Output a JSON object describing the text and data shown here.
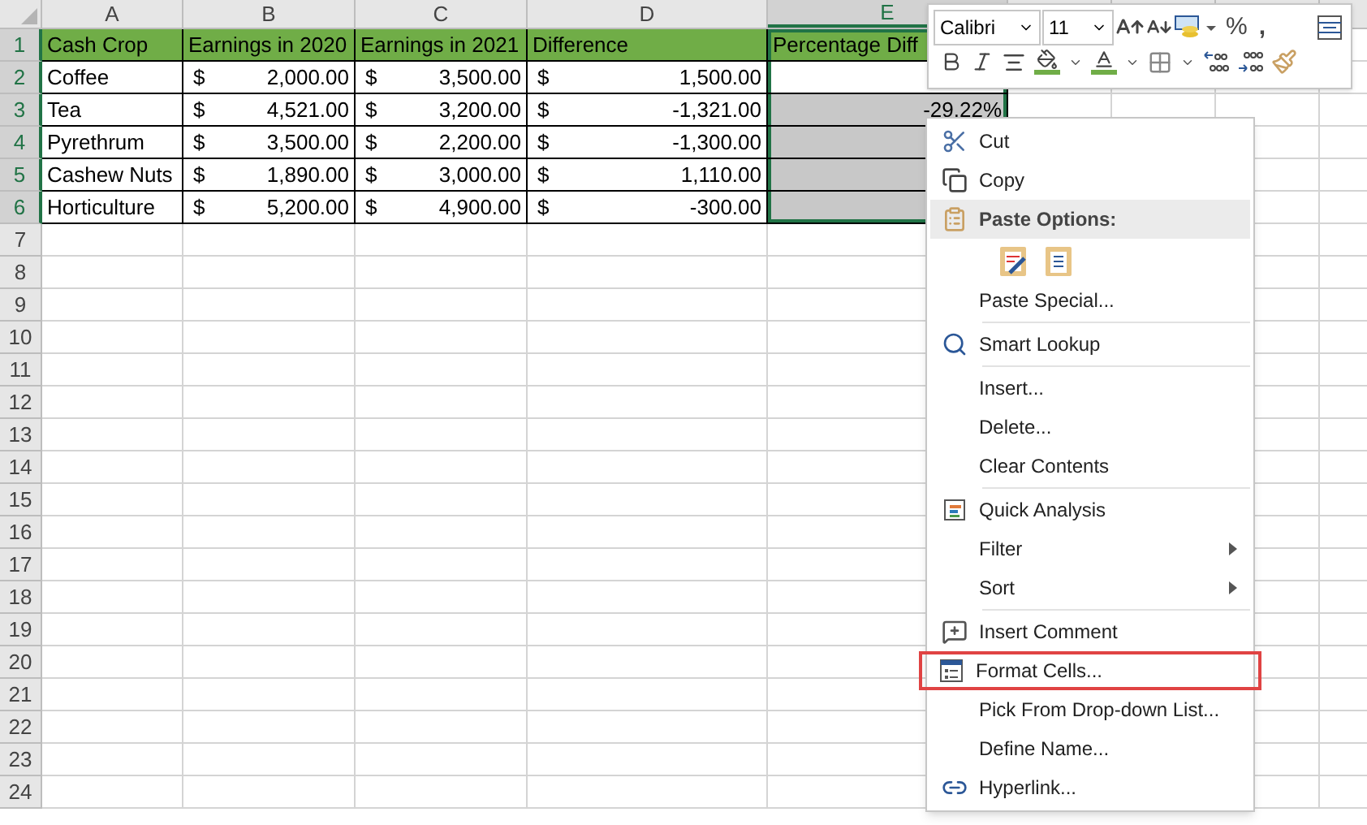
{
  "columns": [
    {
      "label": "A",
      "selected": false
    },
    {
      "label": "B",
      "selected": false
    },
    {
      "label": "C",
      "selected": false
    },
    {
      "label": "D",
      "selected": false
    },
    {
      "label": "E",
      "selected": true
    }
  ],
  "rows": [
    {
      "label": "1",
      "selected": true,
      "cells": [
        {
          "kind": "header",
          "text": "Cash Crop"
        },
        {
          "kind": "header",
          "text": "Earnings in 2020"
        },
        {
          "kind": "header",
          "text": "Earnings in 2021"
        },
        {
          "kind": "header",
          "text": "Difference"
        },
        {
          "kind": "header",
          "text": "Percentage Diff"
        }
      ]
    },
    {
      "label": "2",
      "selected": true,
      "cells": [
        {
          "kind": "text",
          "text": "Coffee"
        },
        {
          "kind": "currency",
          "symbol": "$",
          "amount": "2,000.00"
        },
        {
          "kind": "currency",
          "symbol": "$",
          "amount": "3,500.00"
        },
        {
          "kind": "currency",
          "symbol": "$",
          "amount": "1,500.00"
        },
        {
          "kind": "text",
          "selected": false
        }
      ]
    },
    {
      "label": "3",
      "selected": true,
      "cells": [
        {
          "kind": "text",
          "text": "Tea"
        },
        {
          "kind": "currency",
          "symbol": "$",
          "amount": "4,521.00"
        },
        {
          "kind": "currency",
          "symbol": "$",
          "amount": "3,200.00"
        },
        {
          "kind": "currency",
          "symbol": "$",
          "amount": "-1,321.00"
        },
        {
          "kind": "number",
          "text": "-29.22%",
          "selected": true
        }
      ]
    },
    {
      "label": "4",
      "selected": true,
      "cells": [
        {
          "kind": "text",
          "text": "Pyrethrum"
        },
        {
          "kind": "currency",
          "symbol": "$",
          "amount": "3,500.00"
        },
        {
          "kind": "currency",
          "symbol": "$",
          "amount": "2,200.00"
        },
        {
          "kind": "currency",
          "symbol": "$",
          "amount": "-1,300.00"
        },
        {
          "kind": "text",
          "selected": true
        }
      ]
    },
    {
      "label": "5",
      "selected": true,
      "cells": [
        {
          "kind": "text",
          "text": "Cashew Nuts"
        },
        {
          "kind": "currency",
          "symbol": "$",
          "amount": "1,890.00"
        },
        {
          "kind": "currency",
          "symbol": "$",
          "amount": "3,000.00"
        },
        {
          "kind": "currency",
          "symbol": "$",
          "amount": "1,110.00"
        },
        {
          "kind": "text",
          "selected": true
        }
      ]
    },
    {
      "label": "6",
      "selected": true,
      "cells": [
        {
          "kind": "text",
          "text": "Horticulture"
        },
        {
          "kind": "currency",
          "symbol": "$",
          "amount": "5,200.00"
        },
        {
          "kind": "currency",
          "symbol": "$",
          "amount": "4,900.00"
        },
        {
          "kind": "currency",
          "symbol": "$",
          "amount": "-300.00"
        },
        {
          "kind": "text",
          "selected": true
        }
      ]
    },
    {
      "label": "7",
      "selected": false
    },
    {
      "label": "8",
      "selected": false
    },
    {
      "label": "9",
      "selected": false
    },
    {
      "label": "10",
      "selected": false
    },
    {
      "label": "11",
      "selected": false
    },
    {
      "label": "12",
      "selected": false
    },
    {
      "label": "13",
      "selected": false
    },
    {
      "label": "14",
      "selected": false
    },
    {
      "label": "15",
      "selected": false
    },
    {
      "label": "16",
      "selected": false
    },
    {
      "label": "17",
      "selected": false
    },
    {
      "label": "18",
      "selected": false
    },
    {
      "label": "19",
      "selected": false
    },
    {
      "label": "20",
      "selected": false
    },
    {
      "label": "21",
      "selected": false
    },
    {
      "label": "22",
      "selected": false
    },
    {
      "label": "23",
      "selected": false
    },
    {
      "label": "24",
      "selected": false
    }
  ],
  "mini_toolbar": {
    "font": "Calibri",
    "size": "11",
    "percent": "%",
    "comma": ","
  },
  "context_menu": [
    {
      "kind": "item",
      "label": "Cut"
    },
    {
      "kind": "item",
      "label": "Copy"
    },
    {
      "kind": "header",
      "label": "Paste Options:"
    },
    {
      "kind": "paste_icons"
    },
    {
      "kind": "item",
      "label": "Paste Special..."
    },
    {
      "kind": "item",
      "label": "Smart Lookup",
      "separator_before": true
    },
    {
      "kind": "item",
      "label": "Insert...",
      "separator_before": true
    },
    {
      "kind": "item",
      "label": "Delete..."
    },
    {
      "kind": "item",
      "label": "Clear Contents"
    },
    {
      "kind": "item",
      "label": "Quick Analysis",
      "separator_before": true
    },
    {
      "kind": "item",
      "label": "Filter",
      "submenu": true
    },
    {
      "kind": "item",
      "label": "Sort",
      "submenu": true
    },
    {
      "kind": "item",
      "label": "Insert Comment",
      "separator_before": true
    },
    {
      "kind": "item",
      "label": "Format Cells...",
      "outlined": true
    },
    {
      "kind": "item",
      "label": "Pick From Drop-down List..."
    },
    {
      "kind": "item",
      "label": "Define Name..."
    },
    {
      "kind": "item",
      "label": "Hyperlink..."
    }
  ]
}
